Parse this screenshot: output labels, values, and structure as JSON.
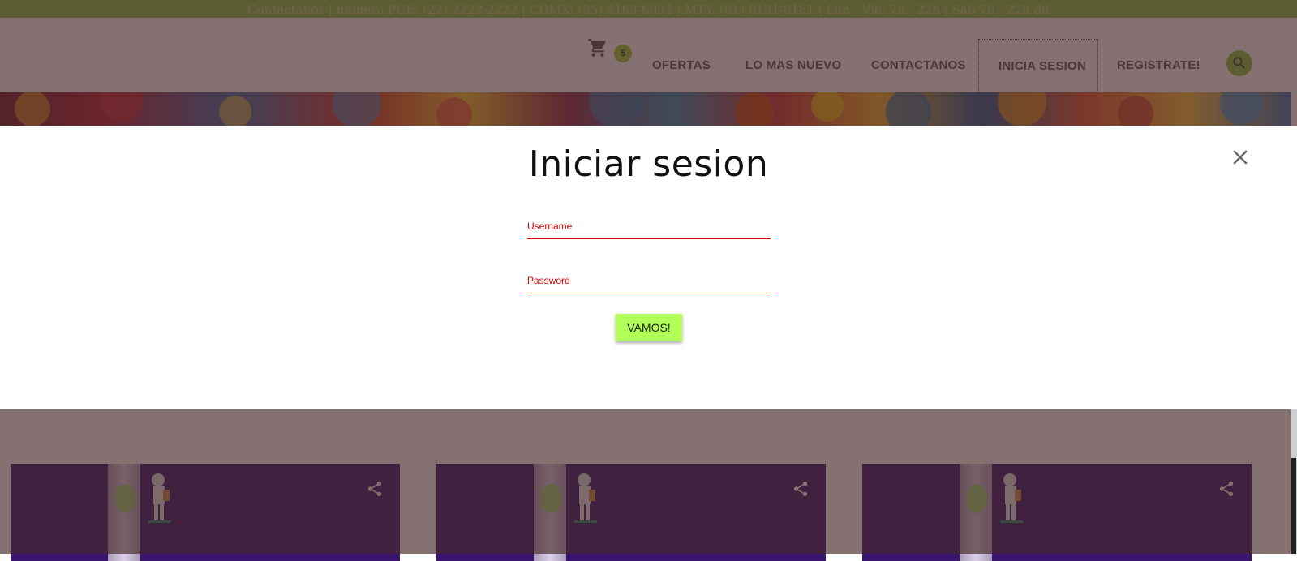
{
  "topbar": {
    "text": "Contactanos | numero PUE: (22) 2222-2222 | CDMX: (55) 4163-6084 | MTY: (81) 8181-8181 | Lun - Vie: 7h - 22h | Sab 7h - 22h dd"
  },
  "header": {
    "cart_icon": "shopping-cart-icon",
    "cart_count": "5",
    "nav": [
      {
        "label": "OFERTAS"
      },
      {
        "label": "LO MAS NUEVO"
      },
      {
        "label": "CONTACTANOS"
      },
      {
        "label": "INICIA SESION",
        "active": true
      },
      {
        "label": "REGISTRATE!"
      }
    ],
    "search_icon": "search-icon"
  },
  "modal": {
    "title": "Iniciar sesion",
    "close_icon": "close-icon",
    "username_label": "Username",
    "password_label": "Password",
    "submit_label": "VAMOS!"
  },
  "cards": [
    {
      "share_icon": "share-icon"
    },
    {
      "share_icon": "share-icon"
    },
    {
      "share_icon": "share-icon"
    }
  ],
  "colors": {
    "accent_green": "#8bc34a",
    "button_green": "#b2ff59",
    "error_red": "#d50000",
    "overlay": "#462828"
  }
}
